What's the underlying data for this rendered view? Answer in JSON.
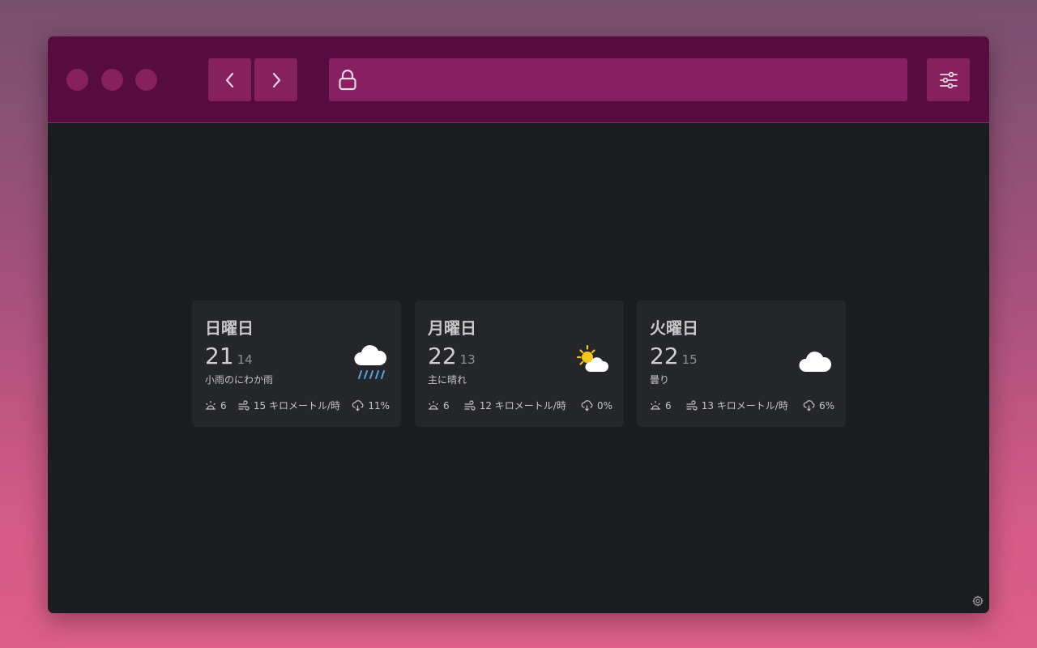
{
  "browser": {
    "window_dots": [
      "dot-close",
      "dot-minimize",
      "dot-maximize"
    ],
    "back_icon": "chevron-left-icon",
    "forward_icon": "chevron-right-icon",
    "url_icon": "lock-icon",
    "url_value": "",
    "settings_icon": "sliders-icon"
  },
  "forecast": [
    {
      "day": "日曜日",
      "high": "21",
      "low": "14",
      "condition": "小雨のにわか雨",
      "icon": "rain-cloud-icon",
      "uv": "6",
      "wind": "15 キロメートル/時",
      "precip": "11%"
    },
    {
      "day": "月曜日",
      "high": "22",
      "low": "13",
      "condition": "主に晴れ",
      "icon": "partly-sunny-icon",
      "uv": "6",
      "wind": "12 キロメートル/時",
      "precip": "0%"
    },
    {
      "day": "火曜日",
      "high": "22",
      "low": "15",
      "condition": "曇り",
      "icon": "cloud-icon",
      "uv": "6",
      "wind": "13 キロメートル/時",
      "precip": "6%"
    }
  ],
  "colors": {
    "titlebar": "#570c40",
    "button": "#86205f",
    "content_bg": "#1b1c1f",
    "card_bg": "#25262a",
    "sun": "#f5c518",
    "rain": "#4fa3e0"
  },
  "footer": {
    "settings_icon": "gear-icon"
  }
}
